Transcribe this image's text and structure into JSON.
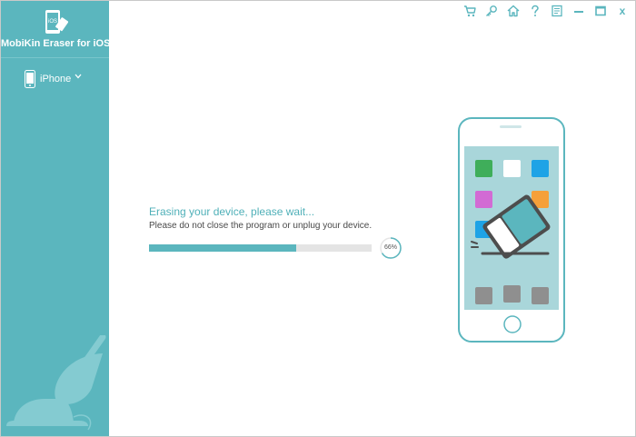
{
  "app": {
    "title": "MobiKin Eraser for iOS",
    "logo_text": "iOS"
  },
  "sidebar": {
    "device": {
      "name": "iPhone",
      "dropdown_icon": "chevron-down-icon"
    }
  },
  "toolbar": {
    "icons": [
      "cart-icon",
      "key-icon",
      "home-icon",
      "help-icon",
      "feedback-icon",
      "minimize-icon",
      "maximize-icon",
      "close-icon"
    ],
    "close_label": "x"
  },
  "status": {
    "title": "Erasing your device, please wait...",
    "subtitle": "Please do not close the program or unplug your device.",
    "progress_percent": 66,
    "progress_label": "66%"
  },
  "colors": {
    "accent": "#5bb6be",
    "track": "#e4e4e4",
    "app_green": "#3fae5a",
    "app_blue": "#1ea3e6",
    "app_pink": "#d26bd4",
    "app_orange": "#f5a03a",
    "app_gray": "#8f8f8f"
  }
}
